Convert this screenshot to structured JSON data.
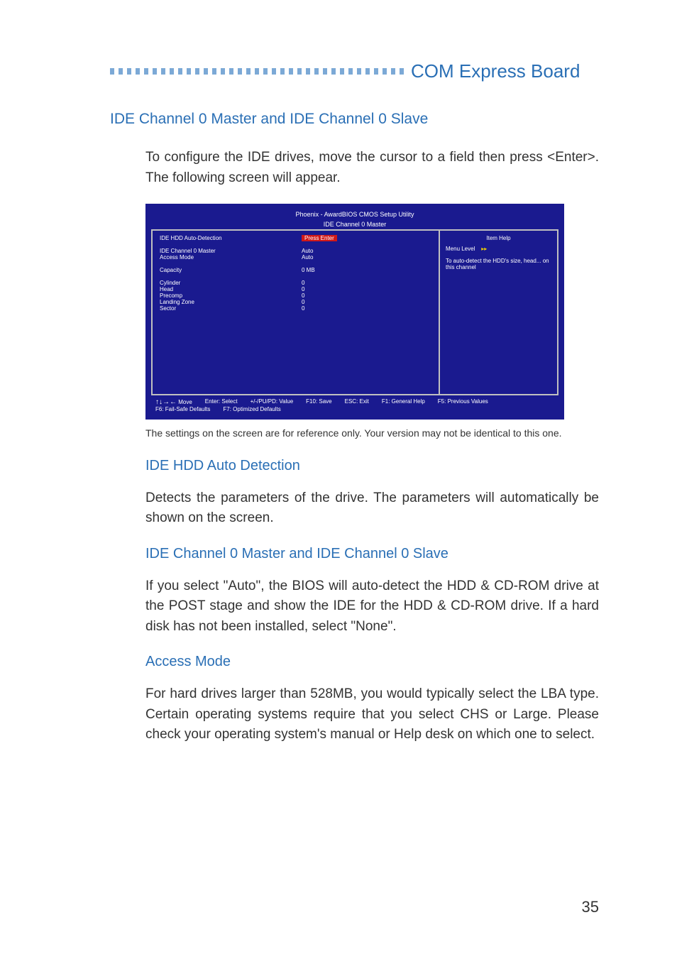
{
  "header": {
    "title": "COM Express Board"
  },
  "section": {
    "title": "IDE Channel 0 Master and IDE Channel 0 Slave",
    "intro": "To configure the IDE drives, move the cursor to a field then press <Enter>. The following screen will appear."
  },
  "bios": {
    "title": "Phoenix - AwardBIOS CMOS Setup Utility",
    "subtitle": "IDE Channel 0 Master",
    "rows": [
      {
        "label": "IDE HDD Auto-Detection",
        "value": "Press Enter",
        "highlight": true
      },
      {
        "label": "",
        "value": ""
      },
      {
        "label": "IDE Channel 0 Master",
        "value": "Auto"
      },
      {
        "label": "Access Mode",
        "value": "Auto"
      },
      {
        "label": "",
        "value": ""
      },
      {
        "label": "Capacity",
        "value": "0 MB"
      },
      {
        "label": "",
        "value": ""
      },
      {
        "label": "Cylinder",
        "value": "0"
      },
      {
        "label": "Head",
        "value": "0"
      },
      {
        "label": "Precomp",
        "value": "0"
      },
      {
        "label": "Landing Zone",
        "value": "0"
      },
      {
        "label": "Sector",
        "value": "0"
      }
    ],
    "help": {
      "title": "Item Help",
      "menu_level_label": "Menu Level",
      "arrow": "▸▸",
      "text": "To auto-detect the HDD's size, head... on this channel"
    },
    "footer": [
      "↑↓→← Move",
      "Enter: Select",
      "+/-/PU/PD: Value",
      "F10: Save",
      "ESC: Exit",
      "F1: General Help",
      "F5: Previous Values",
      "F6: Fail-Safe Defaults",
      "F7: Optimized Defaults"
    ]
  },
  "caption": "The settings on the screen are for reference only. Your version may not be identical to this one.",
  "subsections": [
    {
      "title": "IDE HDD Auto Detection",
      "text": "Detects the parameters of the drive. The parameters will automatically be shown on the screen."
    },
    {
      "title": "IDE Channel 0 Master and IDE Channel 0 Slave",
      "text": "If you select \"Auto\", the BIOS will auto-detect the HDD & CD-ROM drive at the POST stage and show the IDE for the HDD & CD-ROM drive. If a hard disk has not been installed, select \"None\"."
    },
    {
      "title": "Access Mode",
      "text": "For hard drives larger than 528MB, you would typically select the LBA type. Certain operating systems require that you select CHS or Large. Please check your operating system's manual or Help desk on which one to select."
    }
  ],
  "page_number": "35"
}
